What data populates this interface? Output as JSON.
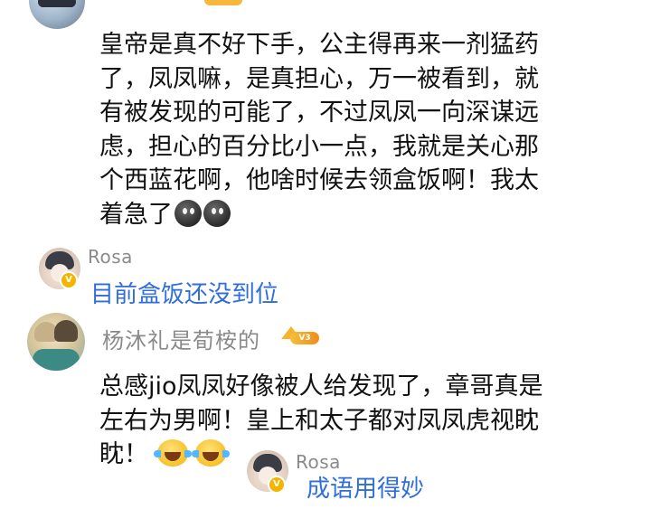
{
  "comments": [
    {
      "username": "",
      "body_lines": [
        "皇帝是真不好下手，公主得再来一剂猛药",
        "了，凤凤嘛，是真担心，万一被看到，就",
        "有被发现的可能了，不过凤凤一向深谋远",
        "虑，担心的百分比小一点，我就是关心那",
        "个西蓝花啊，他啥时候去领盒饭啊！我太",
        "着急了"
      ],
      "trailing_emojis": [
        "dark-grin-emoji",
        "dark-grin-emoji"
      ],
      "reply": {
        "username": "Rosa",
        "badge": "V",
        "text": "目前盒饭还没到位"
      }
    },
    {
      "username": "杨沐礼是荀桉的",
      "level_badge": "V3",
      "body_lines": [
        "总感jio凤凤好像被人给发现了，章哥真是",
        "左右为男啊！皇上和太子都对凤凤虎视眈",
        "眈！"
      ],
      "trailing_emojis": [
        "laugh-cry-emoji",
        "laugh-cry-emoji"
      ],
      "reply": {
        "username": "Rosa",
        "badge": "V",
        "text": "成语用得妙"
      }
    }
  ],
  "colors": {
    "body_text": "#111111",
    "username": "#8a8a8a",
    "reply_text": "#2f6edb",
    "vip_badge": "#f4b400"
  }
}
